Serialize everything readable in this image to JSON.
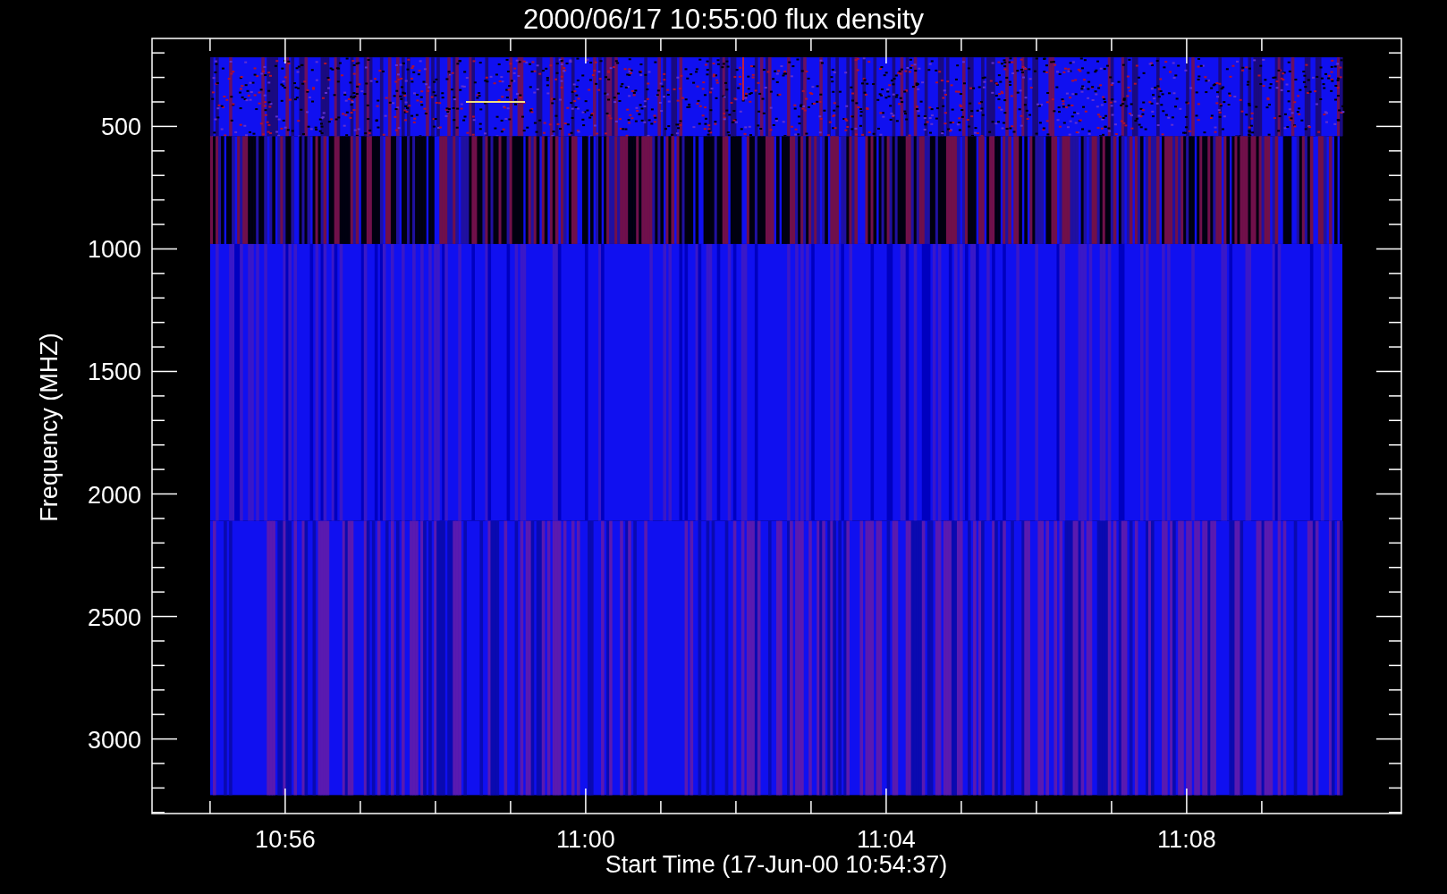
{
  "plot": {
    "title": "2000/06/17 10:55:00 flux density",
    "xlabel": "Start Time (17-Jun-00 10:54:37)",
    "ylabel": "Frequency (MHZ)",
    "xticks": [
      "10:56",
      "11:00",
      "11:04",
      "11:08"
    ],
    "yticks": [
      "500",
      "1000",
      "1500",
      "2000",
      "2500",
      "3000"
    ]
  }
}
